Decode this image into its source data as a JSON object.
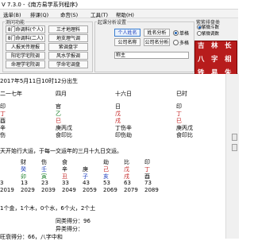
{
  "window": {
    "title": "V 7.3.0 -《南方易学系列程序》"
  },
  "menu": [
    "选单(B)",
    "排课(Q)",
    "命宫(S)",
    "工具(T)",
    "帮助(H)"
  ],
  "panel": {
    "group1": "测问功能",
    "group2": "起课分析设置",
    "group3": "紫紫排盘类",
    "left_buttons": [
      [
        "8门命调料(个人)",
        "三才地理料"
      ],
      [
        "8门命调料(二人)",
        "地支理气调"
      ],
      [
        "人报关传理报",
        "紫调盘字"
      ],
      [
        "阳宅学宅院调",
        "风水学报调"
      ],
      [
        "命理学宅院调",
        "学命宅调盘"
      ]
    ],
    "name_button": "个人姓名",
    "name_analysis_button": "姓名分析",
    "company_button": "公司名称",
    "company_analysis_button": "公司名分析",
    "radio_single": "单格",
    "radio_multi": "多格",
    "input_label": "称主",
    "r3_opt1": "紫微斗数",
    "r3_opt2": "紫微调数",
    "seal_chars": [
      [
        "吉",
        "林",
        "长"
      ],
      [
        "八",
        "字",
        "相"
      ],
      [
        "铁",
        "易",
        "朱"
      ]
    ]
  },
  "content": {
    "birth_line": "2017年5月11日10时12分出生",
    "row_pillar_names": [
      "二一七年",
      "四月",
      "十六日",
      "巳时"
    ],
    "row_gods": [
      "印",
      "官",
      "日",
      "印"
    ],
    "row_stems": [
      "丁",
      "乙",
      "戊",
      "丁"
    ],
    "row_branches": [
      "酉",
      "巳",
      "戌",
      "巳"
    ],
    "row_hidden": [
      "辛",
      "庚丙戊",
      "丁伤辛",
      "庚丙戊"
    ],
    "row_hidden_gods": [
      "伤",
      "食印比",
      "印伤劫",
      "食印比"
    ],
    "luck_line": "天开始行大运，于每一交运年的三月十九日交运。",
    "luck_gods": [
      "财",
      "伤",
      "食",
      "劫",
      "比",
      "印"
    ],
    "luck_stems": [
      "癸",
      "壬",
      "辛",
      "庚",
      "己",
      "戊",
      "丁"
    ],
    "luck_branches": [
      "卯",
      "寅",
      "丑",
      "子",
      "亥",
      "戌",
      "酉"
    ],
    "luck_ages": [
      "3",
      "13",
      "23",
      "33",
      "43",
      "53",
      "63",
      "73"
    ],
    "luck_years": [
      "2019",
      "2029",
      "2039",
      "2049",
      "2059",
      "2069",
      "2079",
      "2089"
    ],
    "five_elements": "1个金，1个木，0个水，6个火，2个土",
    "same_score": "同类得分：96",
    "diff_score": "异类得分：",
    "bottom": "旺衰得分：66，八字中和"
  }
}
